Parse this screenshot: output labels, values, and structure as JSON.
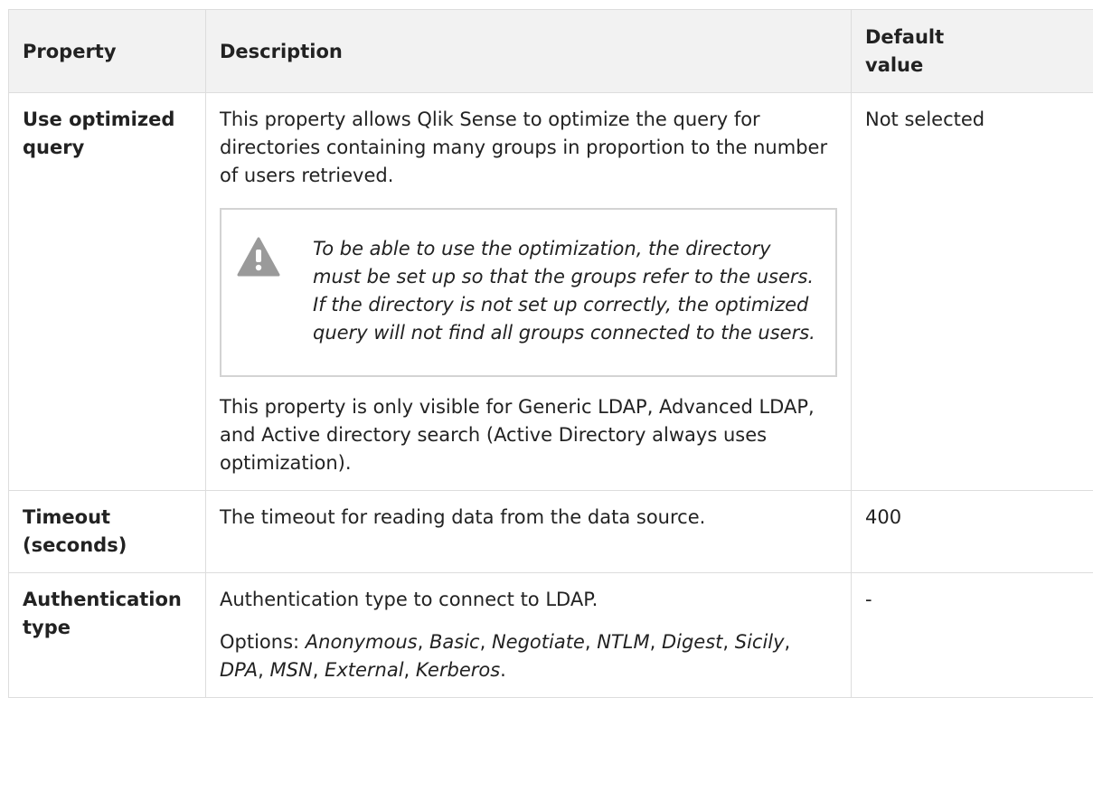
{
  "table": {
    "headers": {
      "property": "Property",
      "description": "Description",
      "default_value": "Default value"
    },
    "rows": [
      {
        "property": "Use optimized query",
        "description_intro": "This property allows Qlik Sense to optimize the query for directories containing many groups in proportion to the number of users retrieved.",
        "warning_icon": "warning-icon",
        "warning_text": "To be able to use the optimization, the directory must be set up so that the groups refer to the users. If the directory is not set up correctly, the optimized query will not find all groups connected to the users.",
        "description_outro": "This property is only visible for Generic LDAP, Advanced LDAP, and Active directory search (Active Directory always uses optimization).",
        "default_value": "Not selected"
      },
      {
        "property": "Timeout (seconds)",
        "description": "The timeout for reading data from the data source.",
        "default_value": "400"
      },
      {
        "property": "Authentication type",
        "description": "Authentication type to connect to LDAP.",
        "options_label": "Options:",
        "options": [
          "Anonymous",
          "Basic",
          "Negotiate",
          "NTLM",
          "Digest",
          "Sicily",
          "DPA",
          "MSN",
          "External",
          "Kerberos"
        ],
        "default_value": "-"
      }
    ]
  },
  "colors": {
    "header_bg": "#f2f2f2",
    "border": "#dddddd",
    "note_border": "#d3d3d3",
    "warning_icon": "#9a9a9a",
    "text": "#222222"
  }
}
